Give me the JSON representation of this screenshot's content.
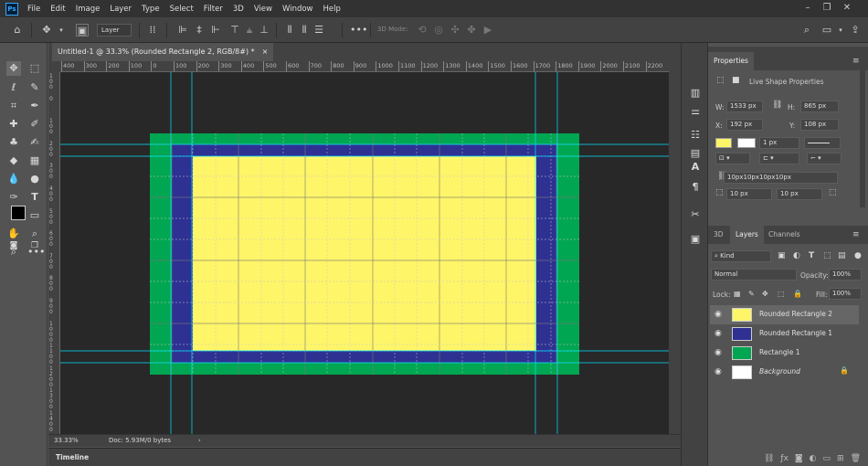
{
  "menu": {
    "logo": "Ps",
    "items": [
      "File",
      "Edit",
      "Image",
      "Layer",
      "Type",
      "Select",
      "Filter",
      "3D",
      "View",
      "Window",
      "Help"
    ]
  },
  "options_bar": {
    "auto_select_target": "Layer",
    "mode_3d_label": "3D Mode:"
  },
  "document": {
    "tab_title": "Untitled-1 @ 33.3% (Rounded Rectangle 2, RGB/8#) *",
    "close_glyph": "×",
    "zoom": "33.33%",
    "doc_info": "Doc: 5.93M/0 bytes",
    "status_arrow": "›"
  },
  "rulers": {
    "h_ticks": [
      "400",
      "300",
      "200",
      "100",
      "0",
      "100",
      "200",
      "300",
      "400",
      "500",
      "600",
      "700",
      "800",
      "900",
      "1000",
      "1100",
      "1200",
      "1300",
      "1400",
      "1500",
      "1600",
      "1700",
      "1800",
      "1900",
      "2000",
      "2100",
      "2200"
    ],
    "v_ticks": [
      "1 0 0",
      "0",
      "1 0 0",
      "2 0 0",
      "3 0 0",
      "4 0 0",
      "5 0 0",
      "6 0 0",
      "7 0 0",
      "8 0 0",
      "9 0 0",
      "1 0 0 0",
      "1 1 0 0",
      "1 2 0 0",
      "1 3 0 0",
      "1 4 0 0"
    ]
  },
  "canvas_colors": {
    "pasteboard": "#282828",
    "green": "#00a651",
    "navy": "#2e3192",
    "yellow": "#fff568",
    "guide": "#00e5ff"
  },
  "timeline": {
    "label": "Timeline"
  },
  "properties": {
    "tab_label": "Properties",
    "section_title": "Live Shape Properties",
    "w_label": "W:",
    "w_value": "1533 px",
    "h_label": "H:",
    "h_value": "865 px",
    "x_label": "X:",
    "x_value": "192 px",
    "y_label": "Y:",
    "y_value": "108 px",
    "stroke_width": "1 px",
    "corner_summary": "10px10px10px10px",
    "corner_tl": "10 px",
    "corner_tr": "10 px",
    "fill_color": "#fff568"
  },
  "layers_panel": {
    "tabs": [
      "3D",
      "Layers",
      "Channels"
    ],
    "active_tab": "Layers",
    "filter_kind": "Kind",
    "blend_mode": "Normal",
    "opacity_label": "Opacity:",
    "opacity_value": "100%",
    "lock_label": "Lock:",
    "fill_label": "Fill:",
    "fill_value": "100%",
    "layers": [
      {
        "name": "Rounded Rectangle 2",
        "color": "#fff568",
        "selected": true,
        "italic": false
      },
      {
        "name": "Rounded Rectangle 1",
        "color": "#2e3192",
        "selected": false,
        "italic": false
      },
      {
        "name": "Rectangle 1",
        "color": "#00a651",
        "selected": false,
        "italic": false
      },
      {
        "name": "Background",
        "color": "#ffffff",
        "selected": false,
        "italic": true
      }
    ]
  }
}
